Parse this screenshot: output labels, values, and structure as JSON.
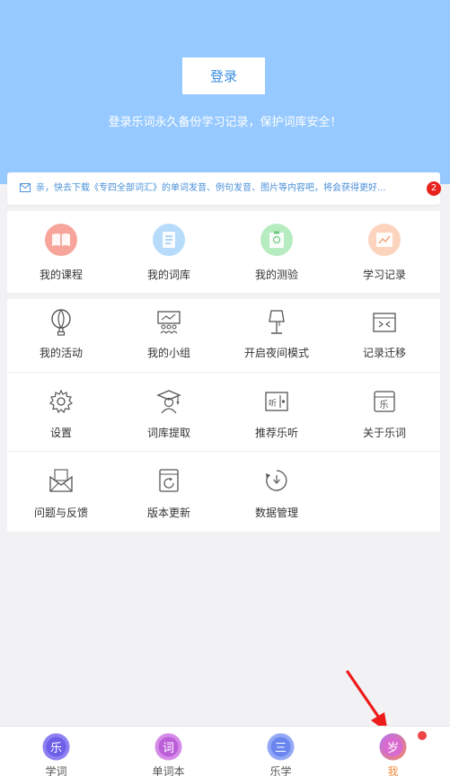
{
  "header": {
    "login_label": "登录",
    "tip": "登录乐词永久备份学习记录，保护词库安全！"
  },
  "notice": {
    "text": "亲，快去下载《专四全部词汇》的单词发音、例句发音、图片等内容吧，将会获得更好...",
    "badge": "2"
  },
  "main_menu": [
    {
      "label": "我的课程",
      "icon": "book-icon"
    },
    {
      "label": "我的词库",
      "icon": "wordbank-icon"
    },
    {
      "label": "我的测验",
      "icon": "test-icon"
    },
    {
      "label": "学习记录",
      "icon": "chart-icon"
    }
  ],
  "more_menu": [
    {
      "label": "我的活动",
      "icon": "balloon-icon"
    },
    {
      "label": "我的小组",
      "icon": "group-icon"
    },
    {
      "label": "开启夜间模式",
      "icon": "lamp-icon"
    },
    {
      "label": "记录迁移",
      "icon": "migrate-icon"
    },
    {
      "label": "设置",
      "icon": "gear-icon"
    },
    {
      "label": "词库提取",
      "icon": "graduate-icon"
    },
    {
      "label": "推荐乐听",
      "icon": "radio-icon"
    },
    {
      "label": "关于乐词",
      "icon": "about-icon"
    },
    {
      "label": "问题与反馈",
      "icon": "envelope-icon"
    },
    {
      "label": "版本更新",
      "icon": "update-icon"
    },
    {
      "label": "数据管理",
      "icon": "data-icon"
    }
  ],
  "tabbar": [
    {
      "label": "学词",
      "glyph": "乐",
      "color": "#7b6cf0",
      "active": false
    },
    {
      "label": "单词本",
      "glyph": "词",
      "color": "#c06ae0",
      "active": false
    },
    {
      "label": "乐学",
      "glyph": "三",
      "color": "#6f8ef0",
      "active": false
    },
    {
      "label": "我",
      "glyph": "岁",
      "color": "#d36ad8",
      "active": true
    }
  ],
  "colors": {
    "hero": "#96c9ff",
    "active_tab": "#f08a3c",
    "badge": "#e8231d"
  }
}
